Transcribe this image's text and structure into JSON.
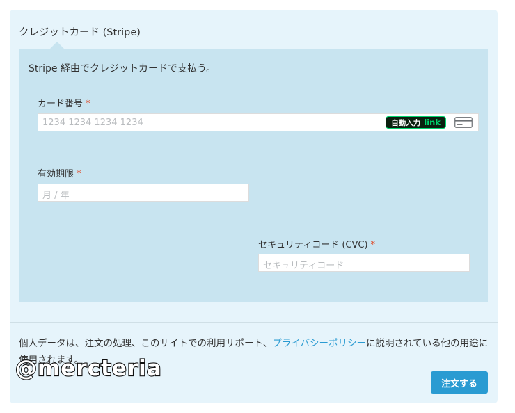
{
  "payment_method": {
    "title": "クレジットカード (Stripe)",
    "description": "Stripe 経由でクレジットカードで支払う。"
  },
  "card_number": {
    "label": "カード番号",
    "required_mark": "*",
    "placeholder": "1234 1234 1234 1234",
    "link_badge": {
      "autofill": "自動入力",
      "link": "link"
    },
    "icon": "credit-card-icon"
  },
  "expiry": {
    "label": "有効期限",
    "required_mark": "*",
    "placeholder": "月 / 年"
  },
  "cvc": {
    "label": "セキュリティコード (CVC)",
    "required_mark": "*",
    "placeholder": "セキュリティコード"
  },
  "privacy": {
    "text_before": "個人データは、注文の処理、このサイトでの利用サポート、",
    "link_text": "プライバシーポリシー",
    "text_after": "に説明されている他の用途に使用されます。"
  },
  "watermark": "@mercteria",
  "order_button": {
    "label": "注文する"
  },
  "colors": {
    "panel": "#e6f4fb",
    "inner_panel": "#c8e4f0",
    "accent": "#2a9bd2",
    "required": "#e2401c",
    "link_green": "#00d66f"
  }
}
